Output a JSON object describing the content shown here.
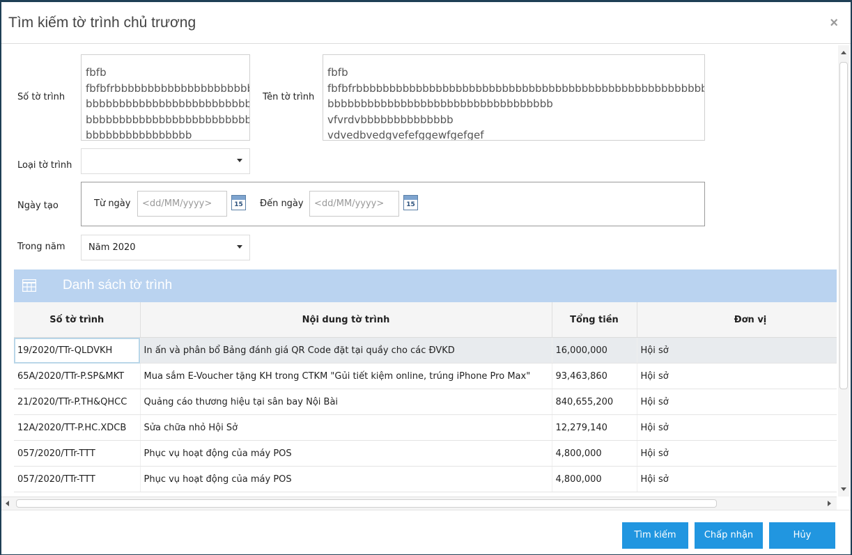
{
  "dialog": {
    "title": "Tìm kiếm tờ trình chủ trương",
    "close": "×"
  },
  "form": {
    "so_to_trinh_label": "Số tờ trình",
    "so_to_trinh_lines": [
      "fbfb",
      "fbfbfrbbbbbbbbbbbbbbbbbbbbb",
      "bbbbbbbbbbbbbbbbbbbbbbbbb",
      "bbbbbbbbbbbbbbbbbbbbbbbbb",
      "bbbbbbbbbbbbbbbb"
    ],
    "ten_to_trinh_label": "Tên tờ trình",
    "ten_to_trinh_lines": [
      "fbfb",
      "fbfbfrbbbbbbbbbbbbbbbbbbbbbbbbbbbbbbbbbbbbbbbbbbbbbbbbbbbbbbbb",
      "bbbbbbbbbbbbbbbbbbbbbbbbbbbbbbbbbb",
      "vfvrdvbbbbbbbbbbbbbb",
      "vdvedbvedgvefefggewfgefgef"
    ],
    "loai_label": "Loại tờ trình",
    "loai_value": "",
    "ngay_tao_label": "Ngày tạo",
    "tu_ngay_label": "Từ ngày",
    "den_ngay_label": "Đến ngày",
    "date_placeholder": "<dd/MM/yyyy>",
    "calendar_day": "15",
    "trong_nam_label": "Trong năm",
    "trong_nam_value": "Năm 2020"
  },
  "grid": {
    "title": "Danh sách tờ trình",
    "columns": [
      "Số tờ trình",
      "Nội dung tờ trình",
      "Tổng tiền",
      "Đơn vị"
    ],
    "rows": [
      [
        "19/2020/TTr-QLDVKH",
        "In ấn và phân bổ Bảng đánh giá QR Code đặt tại quầy cho các ĐVKD",
        "16,000,000",
        "Hội sở"
      ],
      [
        "65A/2020/TTr-P.SP&MKT",
        "Mua sắm E-Voucher tặng KH trong CTKM \"Gủi tiết kiệm online, trúng iPhone Pro Max\"",
        "93,463,860",
        "Hội sở"
      ],
      [
        "21/2020/TTr-P.TH&QHCC",
        "Quảng cáo thương hiệu tại sân bay Nội Bài",
        "840,655,200",
        "Hội sở"
      ],
      [
        "12A/2020/TT-P.HC.XDCB",
        "Sửa chữa nhỏ Hội Sở",
        "12,279,140",
        "Hội sở"
      ],
      [
        "057/2020/TTr-TTT",
        "Phục vụ hoạt động của máy POS",
        "4,800,000",
        "Hội sở"
      ],
      [
        "057/2020/TTr-TTT",
        "Phục vụ hoạt động của máy POS",
        "4,800,000",
        "Hội sở"
      ]
    ]
  },
  "buttons": {
    "search": "Tìm kiếm",
    "accept": "Chấp nhận",
    "cancel": "Hủy"
  },
  "colors": {
    "primary": "#2196e0",
    "grid_header": "#bad3f0"
  }
}
